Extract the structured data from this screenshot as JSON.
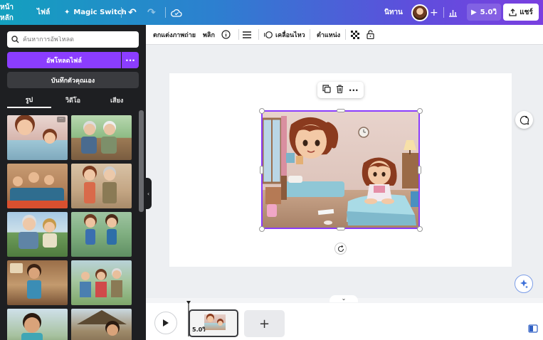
{
  "topbar": {
    "home": "หน้าหลัก",
    "file": "ไฟล์",
    "magic_switch": "Magic Switch",
    "page_name": "นิทาน",
    "play_duration": "5.0วิ",
    "share": "แชร์"
  },
  "sidebar": {
    "search_placeholder": "ค้นหาการอัพโหลด",
    "upload_button": "อัพโหลดไฟล์",
    "record_button": "บันทึกตัวคุณเอง",
    "tabs": [
      "รูป",
      "วิดีโอ",
      "เสียง"
    ],
    "active_tab": "รูป"
  },
  "toolbar": {
    "edit_photo": "ตกแต่งภาพถ่าย",
    "flip": "พลิก",
    "animate": "เคลื่อนไหว",
    "position": "ตำแหน่ง"
  },
  "timeline": {
    "clip_duration": "5.0วิ"
  },
  "colors": {
    "accent": "#8b3dff",
    "sidebar_bg": "#1e1f22"
  }
}
